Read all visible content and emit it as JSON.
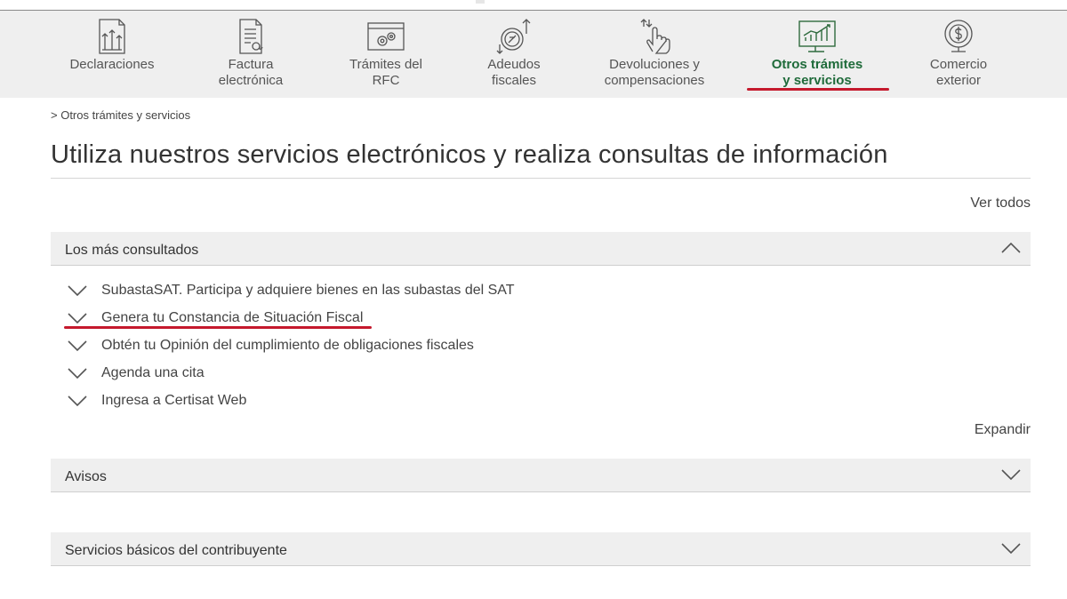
{
  "nav": {
    "items": [
      {
        "label": "Declaraciones",
        "icon": "declaraciones-icon"
      },
      {
        "label": "Factura\nelectrónica",
        "icon": "factura-icon"
      },
      {
        "label": "Trámites del\nRFC",
        "icon": "tramites-rfc-icon"
      },
      {
        "label": "Adeudos\nfiscales",
        "icon": "adeudos-icon"
      },
      {
        "label": "Devoluciones y\ncompensaciones",
        "icon": "devoluciones-icon"
      },
      {
        "label": "Otros trámites\ny servicios",
        "icon": "otros-tramites-icon",
        "active": true
      },
      {
        "label": "Comercio\nexterior",
        "icon": "comercio-exterior-icon"
      }
    ],
    "active_color": "#1f6b3a",
    "underline_color": "#c5192d"
  },
  "breadcrumb": "> Otros trámites y servicios",
  "page_title": "Utiliza nuestros servicios electrónicos y realiza consultas de información",
  "ver_todos": "Ver todos",
  "sections": {
    "mas_consultados": {
      "label": "Los más consultados",
      "expanded": true,
      "items": [
        "SubastaSAT. Participa y adquiere bienes en las subastas del SAT",
        "Genera tu Constancia de Situación Fiscal",
        "Obtén tu Opinión del cumplimiento de obligaciones fiscales",
        "Agenda una cita",
        "Ingresa a Certisat Web"
      ]
    },
    "expandir": "Expandir",
    "avisos": {
      "label": "Avisos",
      "expanded": false
    },
    "servicios_basicos": {
      "label": "Servicios básicos del contribuyente",
      "expanded": false
    }
  }
}
